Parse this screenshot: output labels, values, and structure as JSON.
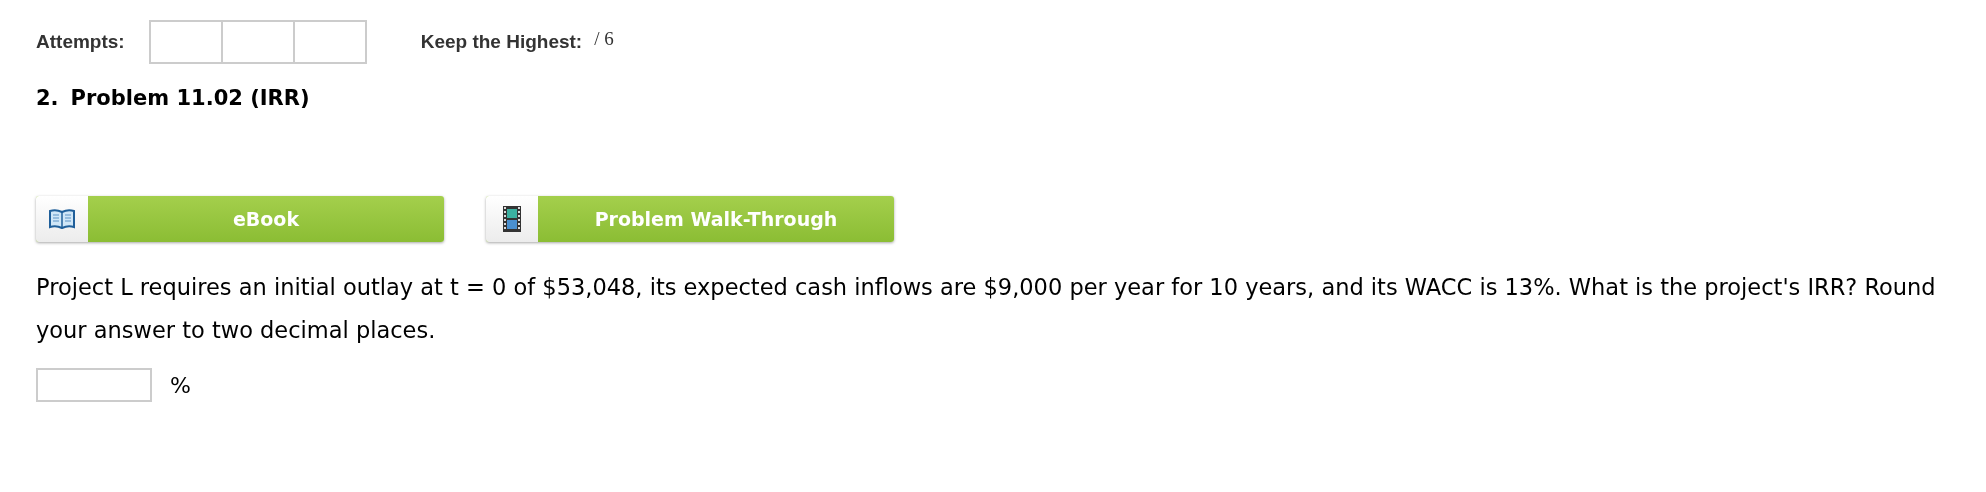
{
  "attempts": {
    "label": "Attempts:",
    "boxes": [
      {
        "filled": false
      },
      {
        "filled": false
      },
      {
        "filled": false
      }
    ]
  },
  "keep_highest": {
    "label": "Keep the Highest:",
    "value": "/ 6"
  },
  "problem": {
    "number": "2.",
    "title": "Problem 11.02 (IRR)"
  },
  "buttons": [
    {
      "kind": "book",
      "label": "eBook"
    },
    {
      "kind": "film",
      "label": "Problem Walk-Through"
    }
  ],
  "question": "Project L requires an initial outlay at t = 0 of $53,048, its expected cash inflows are $9,000 per year for 10 years, and its WACC is 13%. What is the project's IRR? Round your answer to two decimal places.",
  "answer": {
    "unit": "%"
  }
}
